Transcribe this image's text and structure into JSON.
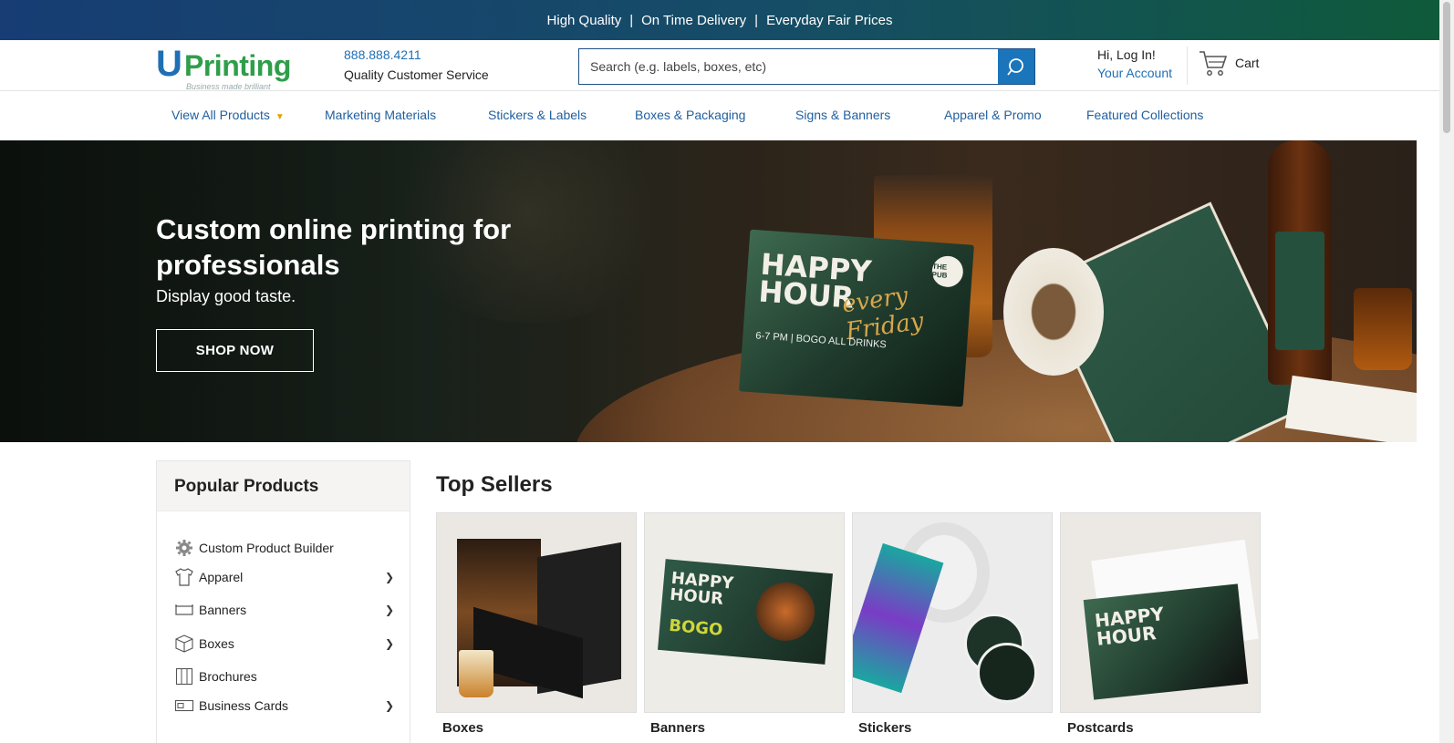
{
  "topbar": {
    "items": [
      "High Quality",
      "On Time Delivery",
      "Everyday Fair Prices"
    ],
    "separator": "|"
  },
  "header": {
    "logo_text_u": "U",
    "logo_text_rest": "Printing",
    "logo_tagline": "Business made brilliant",
    "phone": "888.888.4211",
    "service": "Quality Customer Service",
    "search_placeholder": "Search (e.g. labels, boxes, etc)",
    "login": "Hi, Log In!",
    "account": "Your Account",
    "cart": "Cart"
  },
  "nav": {
    "items": [
      "View All Products",
      "Marketing Materials",
      "Stickers & Labels",
      "Boxes & Packaging",
      "Signs & Banners",
      "Apparel & Promo",
      "Featured Collections"
    ]
  },
  "hero": {
    "title": "Custom online printing for professionals",
    "subtitle": "Display good taste.",
    "cta": "SHOP NOW",
    "card_text_1": "HAPPY",
    "card_text_2": "HOUR",
    "card_script": "every Friday",
    "card_details": "6-7 PM | BOGO ALL DRINKS",
    "brand_mark": "THE PUB"
  },
  "popular": {
    "title": "Popular Products",
    "items": [
      {
        "label": "Custom Product Builder",
        "icon": "gear-icon",
        "has_arrow": false
      },
      {
        "label": "Apparel",
        "icon": "shirt-icon",
        "has_arrow": true
      },
      {
        "label": "Banners",
        "icon": "banner-icon",
        "has_arrow": true
      },
      {
        "label": "Boxes",
        "icon": "box-icon",
        "has_arrow": true
      },
      {
        "label": "Brochures",
        "icon": "brochure-icon",
        "has_arrow": false
      },
      {
        "label": "Business Cards",
        "icon": "business-card-icon",
        "has_arrow": true
      }
    ]
  },
  "top_sellers": {
    "title": "Top Sellers",
    "items": [
      "Boxes",
      "Banners",
      "Stickers",
      "Postcards"
    ]
  },
  "colors": {
    "brand_blue": "#1f6fb5",
    "brand_green": "#2f9e4a",
    "nav_link": "#1f5f9e",
    "search_button": "#1b75bb"
  }
}
